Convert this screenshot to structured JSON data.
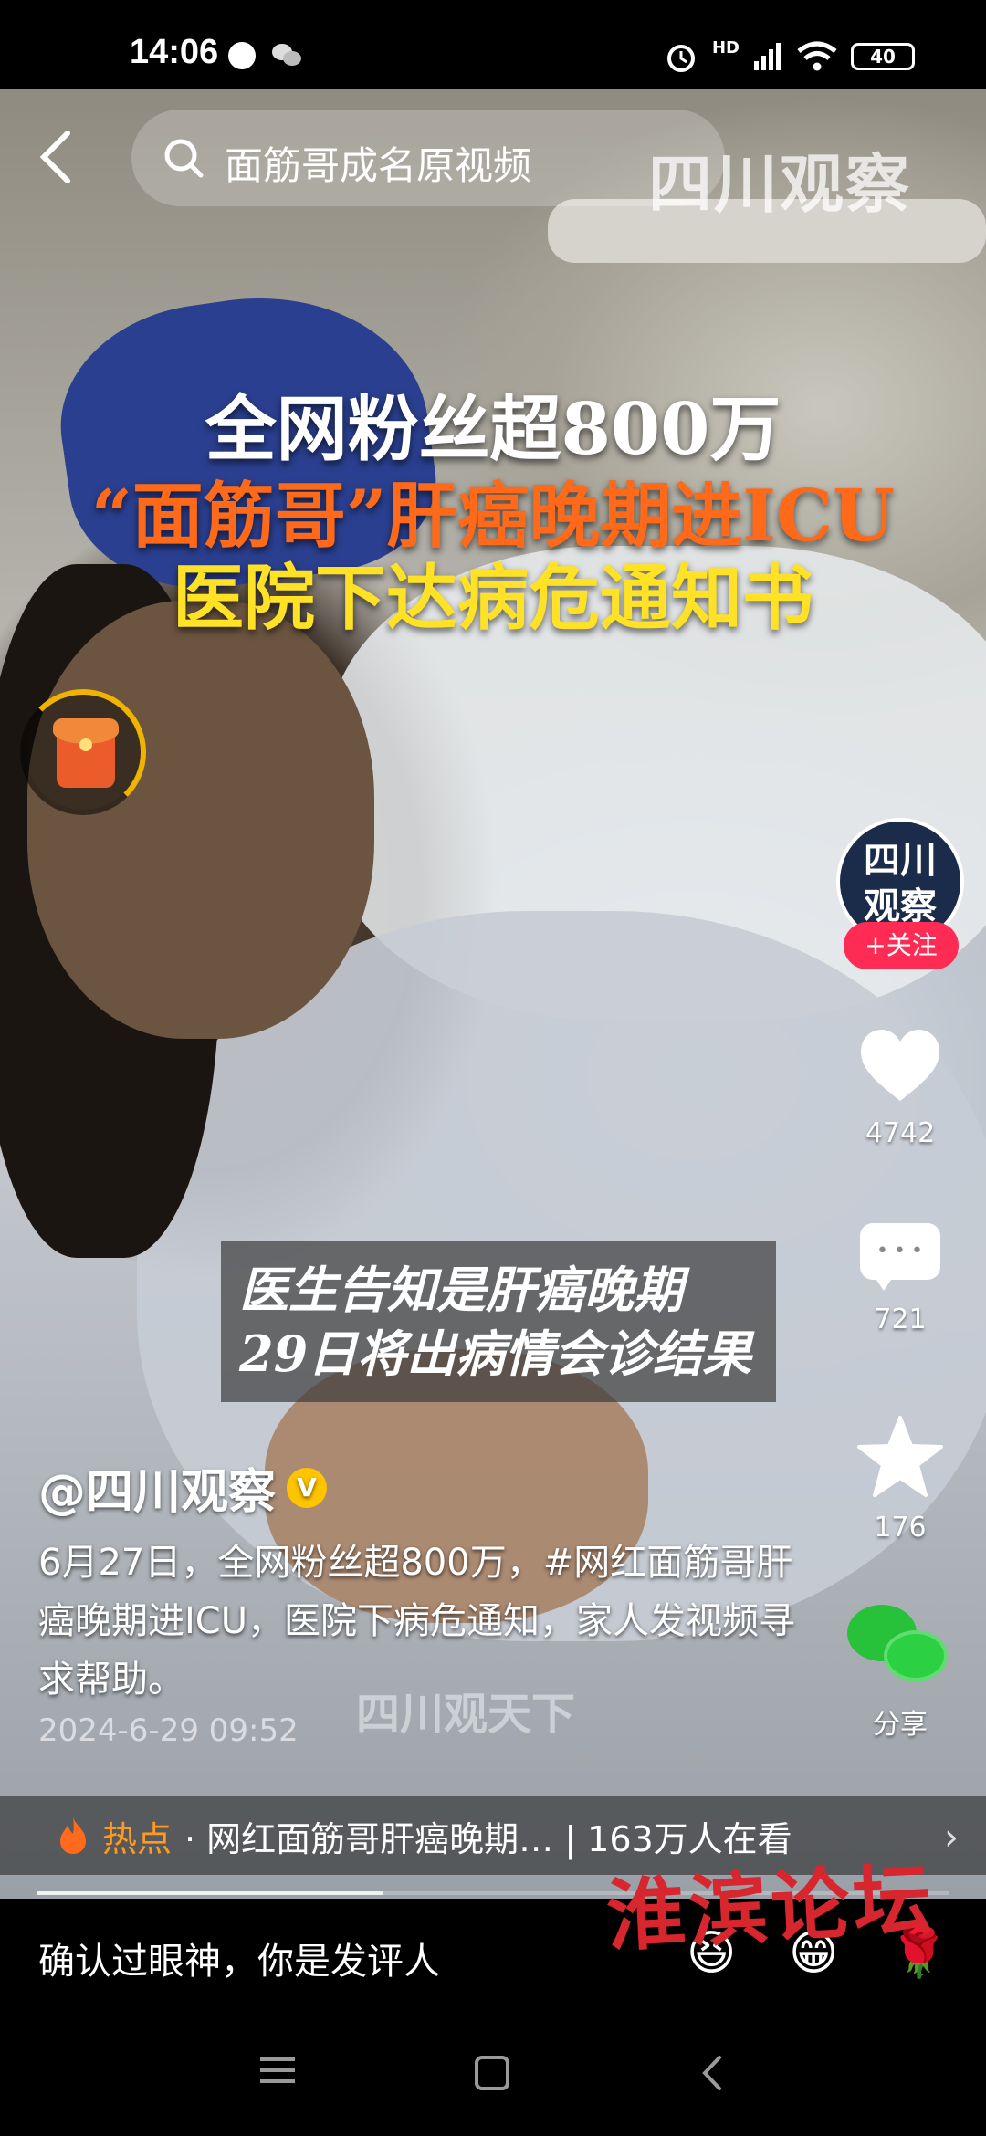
{
  "status_bar": {
    "time": "14:06",
    "network": "HD",
    "battery": "40"
  },
  "search": {
    "query": "面筋哥成名原视频"
  },
  "video": {
    "channel_watermark": "四川观察",
    "headline_lines": [
      "全网粉丝超800万",
      "“面筋哥”肝癌晚期进ICU",
      "医院下达病危通知书"
    ],
    "subtitle_lines": [
      "医生告知是肝癌晚期",
      "29日将出病情会诊结果"
    ],
    "faint_watermark": "四川观天下"
  },
  "creator": {
    "avatar_text_line1": "四川",
    "avatar_text_line2": "观察",
    "follow_label": "+关注",
    "handle": "@四川观察",
    "verified_badge": "V"
  },
  "actions": {
    "like_count": "4742",
    "comment_count": "721",
    "favorite_count": "176",
    "share_label": "分享"
  },
  "post": {
    "description": "6月27日，全网粉丝超800万，#网红面筋哥肝癌晚期进ICU，医院下病危通知，家人发视频寻求帮助。",
    "timestamp": "2024-6-29 09:52"
  },
  "hot": {
    "label": "热点",
    "text": "· 网红面筋哥肝癌晚期… | 163万人在看"
  },
  "playback": {
    "progress": 0.38
  },
  "comment_bar": {
    "placeholder": "确认过眼神，你是发评人"
  },
  "overlay": {
    "forum_watermark": "淮滨论坛"
  },
  "colors": {
    "follow_red": "#fe2c55",
    "hot_orange": "#ff9a1f",
    "headline_orange": "#ff6a1a",
    "headline_yellow": "#ffe226",
    "watermark_red": "#d7262e"
  }
}
